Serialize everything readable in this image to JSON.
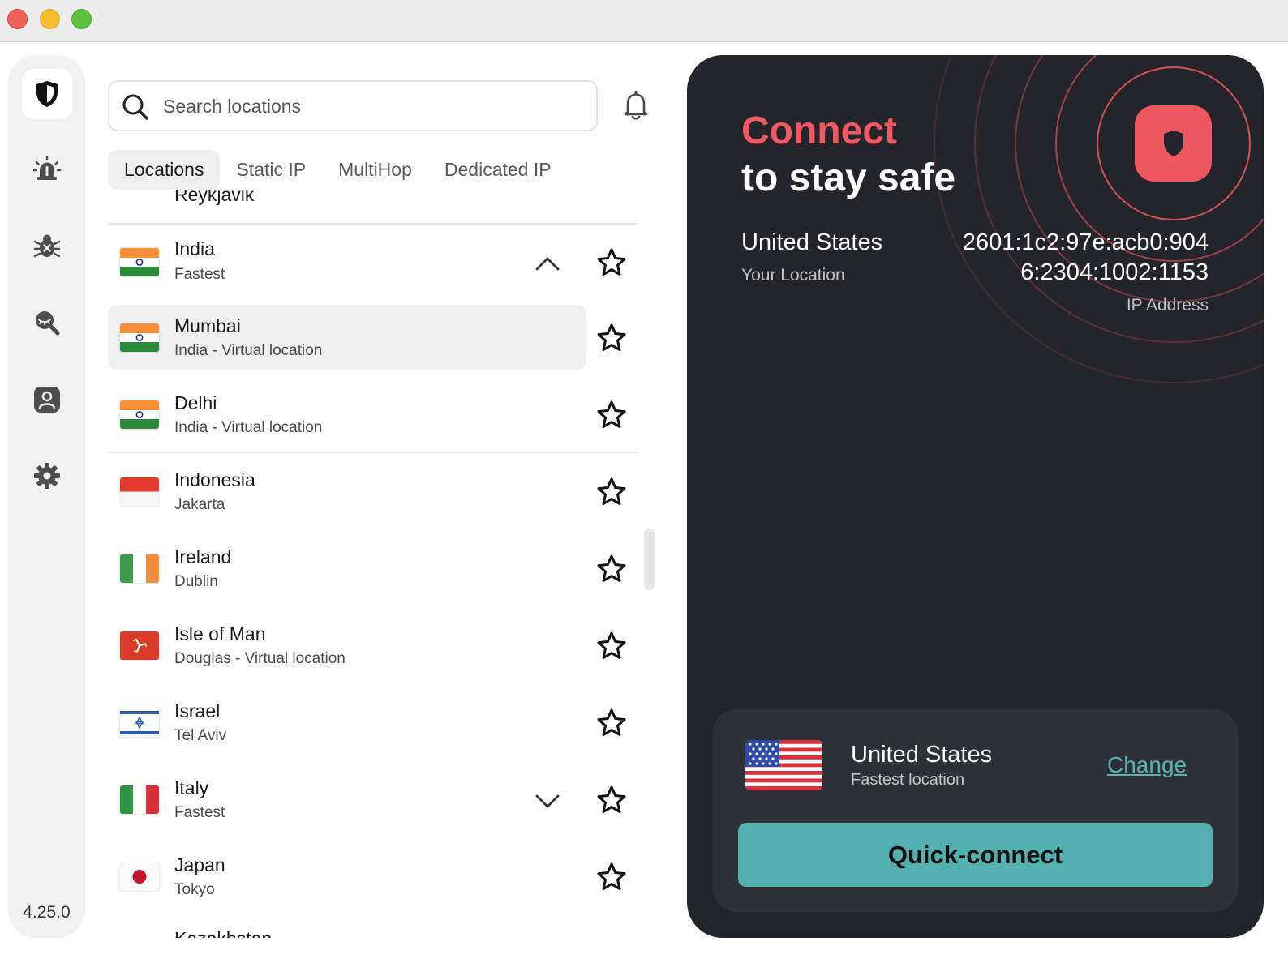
{
  "window": {
    "controls": [
      "close",
      "minimize",
      "zoom"
    ]
  },
  "rail": {
    "items": [
      {
        "name": "shield-logo-icon"
      },
      {
        "name": "alert-icon"
      },
      {
        "name": "bug-icon"
      },
      {
        "name": "dark-web-monitor-icon"
      },
      {
        "name": "account-icon"
      },
      {
        "name": "gear-icon"
      }
    ],
    "version": "4.25.0"
  },
  "search": {
    "placeholder": "Search locations"
  },
  "tabs": [
    {
      "label": "Locations",
      "active": true
    },
    {
      "label": "Static IP",
      "active": false
    },
    {
      "label": "MultiHop",
      "active": false
    },
    {
      "label": "Dedicated IP",
      "active": false
    }
  ],
  "list": {
    "partial_top": "Reykjavik",
    "rows": [
      {
        "name": "India",
        "sub": "Fastest",
        "flag": "india",
        "expandable": true,
        "expanded": true
      },
      {
        "name": "Mumbai",
        "sub": "India - Virtual location",
        "flag": "india",
        "selected": true
      },
      {
        "name": "Delhi",
        "sub": "India - Virtual location",
        "flag": "india"
      },
      {
        "name": "Indonesia",
        "sub": "Jakarta",
        "flag": "indonesia"
      },
      {
        "name": "Ireland",
        "sub": "Dublin",
        "flag": "ireland"
      },
      {
        "name": "Isle of Man",
        "sub": "Douglas - Virtual location",
        "flag": "isle-of-man"
      },
      {
        "name": "Israel",
        "sub": "Tel Aviv",
        "flag": "israel"
      },
      {
        "name": "Italy",
        "sub": "Fastest",
        "flag": "italy",
        "expandable": true,
        "expanded": false
      },
      {
        "name": "Japan",
        "sub": "Tokyo",
        "flag": "japan"
      }
    ],
    "partial_bottom": "Kazakhstan"
  },
  "panel": {
    "heading_accent": "Connect",
    "heading": "to stay safe",
    "location_name": "United States",
    "location_label": "Your Location",
    "ip_line1": "2601:1c2:97e:acb0:904",
    "ip_line2": "6:2304:1002:1153",
    "ip_label": "IP Address",
    "accent_color": "#f25861",
    "quick": {
      "country": "United States",
      "sub": "Fastest location",
      "change_label": "Change",
      "button_label": "Quick-connect",
      "button_color": "#55b0b0"
    }
  }
}
